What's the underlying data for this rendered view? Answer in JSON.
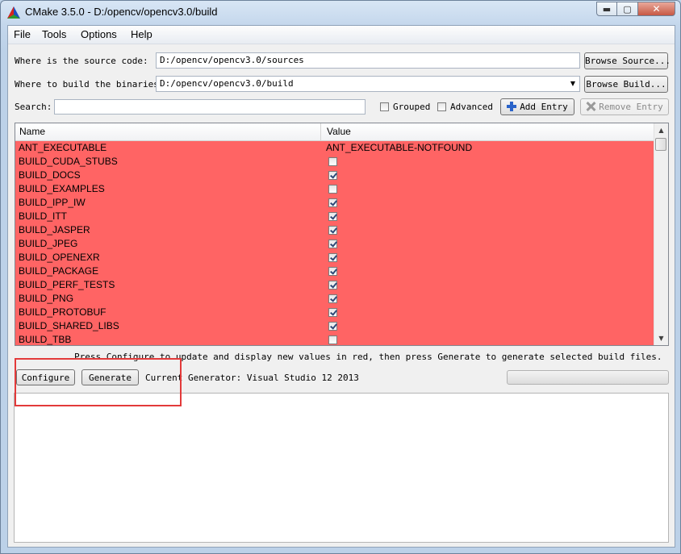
{
  "window": {
    "title": "CMake 3.5.0 - D:/opencv/opencv3.0/build",
    "min_glyph": "▬",
    "max_glyph": "▢",
    "close_glyph": "✕"
  },
  "menu": [
    "File",
    "Tools",
    "Options",
    "Help"
  ],
  "source": {
    "label": "Where is the source code:",
    "value": "D:/opencv/opencv3.0/sources",
    "browse_label": "Browse Source..."
  },
  "binaries": {
    "label": "Where to build the binaries:",
    "value": "D:/opencv/opencv3.0/build",
    "browse_label": "Browse Build..."
  },
  "search": {
    "label": "Search:",
    "value": ""
  },
  "options": {
    "grouped_label": "Grouped",
    "grouped_checked": false,
    "advanced_label": "Advanced",
    "advanced_checked": false,
    "add_entry_label": "Add Entry",
    "remove_entry_label": "Remove Entry"
  },
  "table": {
    "name_header": "Name",
    "value_header": "Value",
    "row_color": "#ff6464",
    "rows": [
      {
        "name": "ANT_EXECUTABLE",
        "type": "text",
        "value": "ANT_EXECUTABLE-NOTFOUND"
      },
      {
        "name": "BUILD_CUDA_STUBS",
        "type": "bool",
        "checked": false
      },
      {
        "name": "BUILD_DOCS",
        "type": "bool",
        "checked": true
      },
      {
        "name": "BUILD_EXAMPLES",
        "type": "bool",
        "checked": false
      },
      {
        "name": "BUILD_IPP_IW",
        "type": "bool",
        "checked": true
      },
      {
        "name": "BUILD_ITT",
        "type": "bool",
        "checked": true
      },
      {
        "name": "BUILD_JASPER",
        "type": "bool",
        "checked": true
      },
      {
        "name": "BUILD_JPEG",
        "type": "bool",
        "checked": true
      },
      {
        "name": "BUILD_OPENEXR",
        "type": "bool",
        "checked": true
      },
      {
        "name": "BUILD_PACKAGE",
        "type": "bool",
        "checked": true
      },
      {
        "name": "BUILD_PERF_TESTS",
        "type": "bool",
        "checked": true
      },
      {
        "name": "BUILD_PNG",
        "type": "bool",
        "checked": true
      },
      {
        "name": "BUILD_PROTOBUF",
        "type": "bool",
        "checked": true
      },
      {
        "name": "BUILD_SHARED_LIBS",
        "type": "bool",
        "checked": true
      },
      {
        "name": "BUILD_TBB",
        "type": "bool",
        "checked": false
      }
    ]
  },
  "hint": "Press Configure to update and display new values in red, then press Generate to generate selected build files.",
  "actions": {
    "configure_label": "Configure",
    "generate_label": "Generate",
    "generator_text": "Current Generator: Visual Studio 12 2013"
  },
  "progress": 0,
  "highlight_color": "#e33a3a"
}
